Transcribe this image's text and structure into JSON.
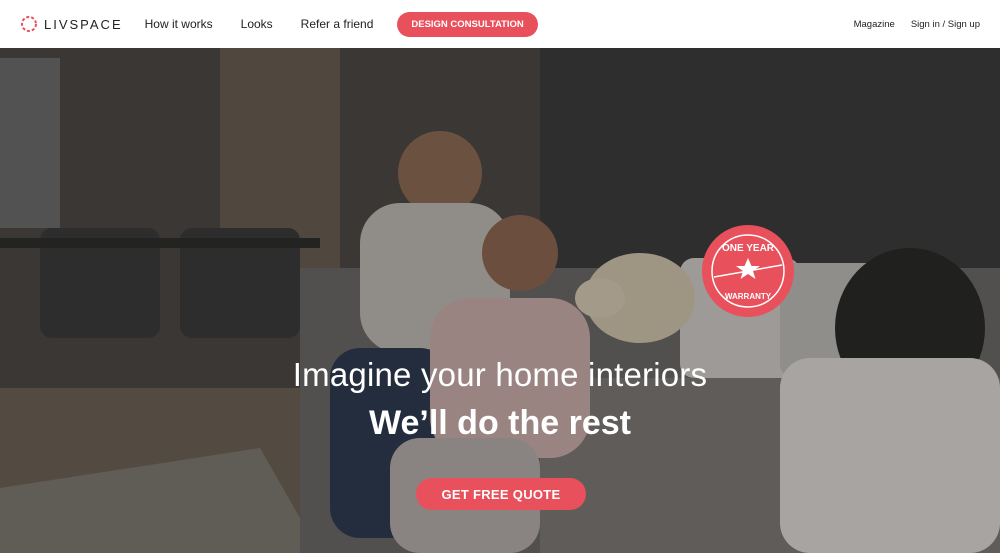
{
  "brand": {
    "name": "LIVSPACE",
    "accent": "#e8505b"
  },
  "nav": {
    "links": [
      "How it works",
      "Looks",
      "Refer a friend"
    ],
    "cta": "DESIGN CONSULTATION",
    "magazine": "Magazine",
    "signin": "Sign in / Sign up"
  },
  "hero": {
    "headline": "Imagine your home interiors",
    "subheadline": "We’ll do the rest",
    "cta": "GET FREE QUOTE",
    "badge_top": "ONE YEAR",
    "badge_bottom": "WARRANTY"
  }
}
